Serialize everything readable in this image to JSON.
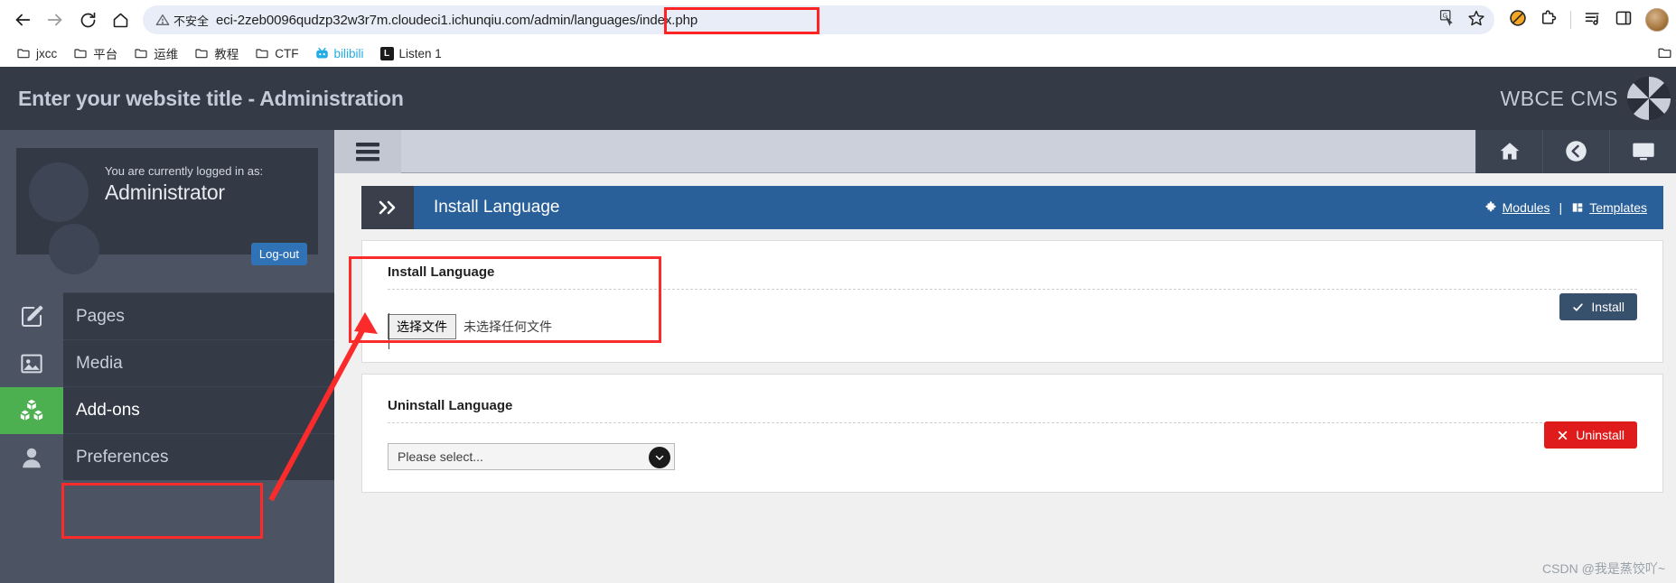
{
  "browser": {
    "nav": {
      "back": "back-arrow",
      "forward": "forward-arrow",
      "reload": "reload",
      "home": "home"
    },
    "security_label": "不安全",
    "url_full": "eci-2zeb0096qudzp32w3r7m.cloudeci1.ichunqiu.com/admin/languages/index.php",
    "url_highlight": "/languages/index.php",
    "bookmarks": [
      {
        "label": "jxcc",
        "icon": "folder-icon"
      },
      {
        "label": "平台",
        "icon": "folder-icon"
      },
      {
        "label": "运维",
        "icon": "folder-icon"
      },
      {
        "label": "教程",
        "icon": "folder-icon"
      },
      {
        "label": "CTF",
        "icon": "folder-icon"
      },
      {
        "label": "bilibili",
        "icon": "bilibili-favicon"
      },
      {
        "label": "Listen 1",
        "icon": "listen1-favicon"
      }
    ],
    "toolbar_icons": [
      "translate-icon",
      "bookmark-star-icon",
      "adblock-icon",
      "extensions-icon",
      "reading-list-icon",
      "side-panel-icon",
      "profile-avatar"
    ]
  },
  "cms": {
    "header": {
      "title": "Enter your website title - Administration",
      "brand": "WBCE CMS"
    },
    "sidebar": {
      "logged_in_as": "You are currently logged in as:",
      "username": "Administrator",
      "logout_label": "Log-out",
      "items": [
        {
          "label": "Pages",
          "icon": "pencil-square-icon",
          "active": false
        },
        {
          "label": "Media",
          "icon": "image-icon",
          "active": false
        },
        {
          "label": "Add-ons",
          "icon": "boxes-icon",
          "active": true
        },
        {
          "label": "Preferences",
          "icon": "user-icon",
          "active": false
        }
      ]
    },
    "topbar": {
      "menu_icon": "hamburger-icon",
      "icons": [
        "home-icon",
        "back-circle-icon",
        "monitor-icon"
      ]
    },
    "panel": {
      "expand_icon": "double-chevron-right-icon",
      "title": "Install Language",
      "links": [
        {
          "label": "Modules",
          "icon": "puzzle-icon"
        },
        {
          "label": "Templates",
          "icon": "layout-icon"
        }
      ],
      "separator": "|"
    },
    "install_card": {
      "title": "Install Language",
      "file_button": "选择文件",
      "file_status": "未选择任何文件",
      "submit_label": "Install",
      "submit_icon": "check-icon"
    },
    "uninstall_card": {
      "title": "Uninstall Language",
      "select_value": "Please select...",
      "select_icon": "chevron-down-circle-icon",
      "submit_label": "Uninstall",
      "submit_icon": "x-icon"
    },
    "colors": {
      "header_bg": "#343a46",
      "sidebar_bg": "#4c5464",
      "panel_blue": "#2a6099",
      "addons_green": "#4caf50",
      "install_btn": "#37506b",
      "uninstall_btn": "#e01b1b",
      "annotation_red": "#fb2b2b"
    }
  },
  "watermark": "CSDN @我是蒸饺吖~"
}
